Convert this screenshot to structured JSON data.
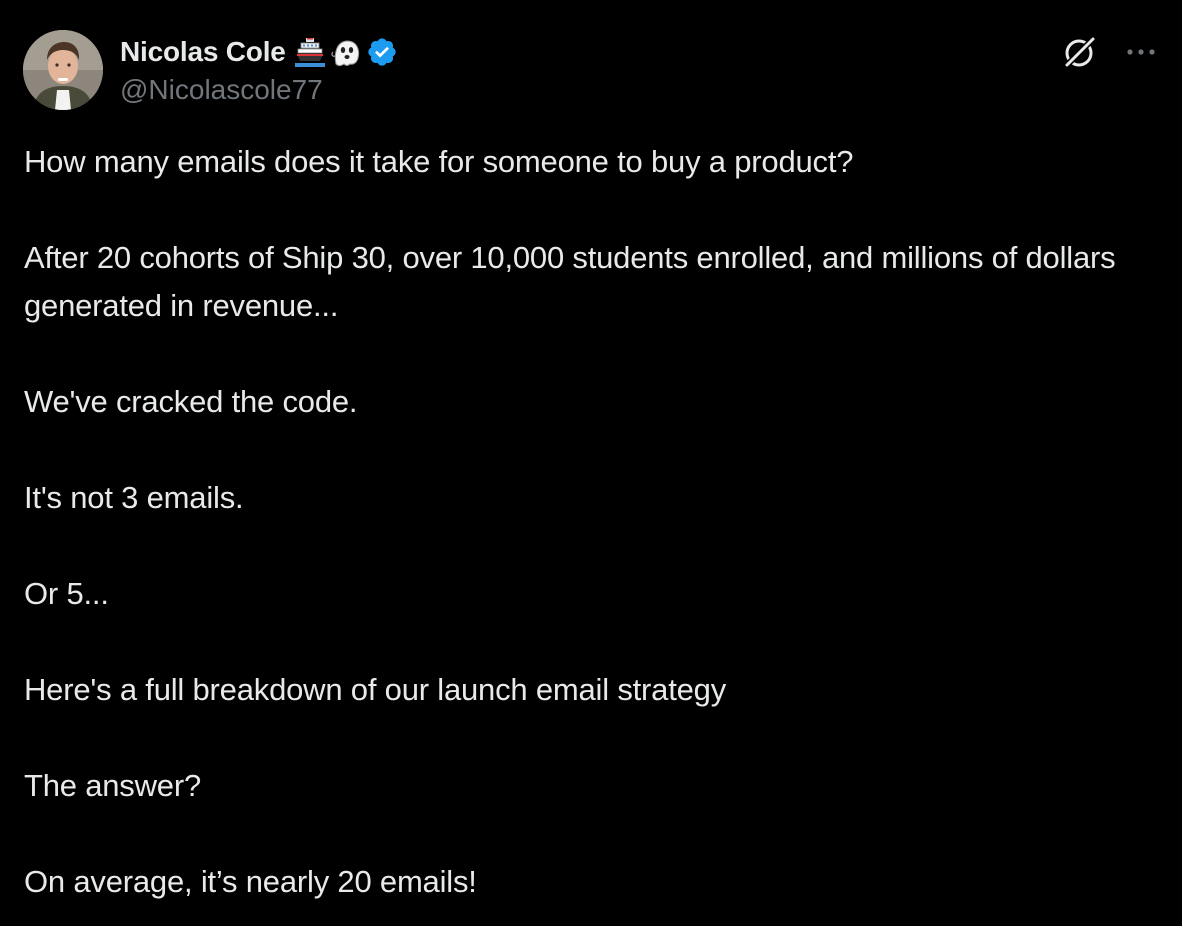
{
  "author": {
    "display_name": "Nicolas Cole",
    "handle": "@Nicolascole77",
    "emoji_1": "ship",
    "emoji_2": "ghost",
    "verified_color": "#1d9bf0"
  },
  "actions": {
    "grok_icon": "grok-icon",
    "more_icon": "more-icon"
  },
  "tweet": {
    "paragraphs": [
      "How many emails does it take for someone to buy a product?",
      "After 20 cohorts of Ship 30, over 10,000 students enrolled, and millions of dollars generated in revenue...",
      "We've cracked the code.",
      "It's not 3 emails.",
      "Or 5...",
      "Here's a full breakdown of our launch email strategy",
      "The answer?",
      "On average, it’s nearly 20 emails!"
    ]
  },
  "colors": {
    "background": "#000000",
    "text": "#e7e9ea",
    "secondary": "#71767b",
    "accent": "#1d9bf0"
  }
}
